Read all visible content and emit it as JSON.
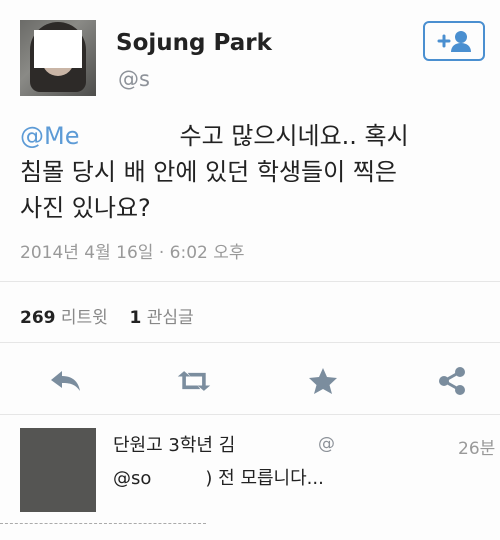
{
  "profile": {
    "display_name": "Sojung Park",
    "handle": "@s"
  },
  "tweet": {
    "mention": "@Me",
    "line1_rest": "수고 많으시네요.. 혹시",
    "line2": "침몰 당시 배 안에 있던 학생들이 찍은",
    "line3": "사진 있나요?",
    "timestamp": "2014년 4월 16일 · 6:02 오후"
  },
  "stats": {
    "retweets": "269",
    "retweets_label": "리트윗",
    "favorites": "1",
    "favorites_label": "관심글"
  },
  "actions": {
    "icons": [
      "reply-icon",
      "retweet-icon",
      "favorite-icon",
      "share-icon"
    ]
  },
  "reply": {
    "name": "단원고 3학년 김",
    "handle": "@",
    "time": "26분",
    "mention": "@so",
    "mention_end": ")",
    "text": "전 모릅니다..."
  },
  "colors": {
    "accent": "#4a8fd0",
    "icon": "#7b8d9e",
    "mention": "#5d9bd6"
  }
}
